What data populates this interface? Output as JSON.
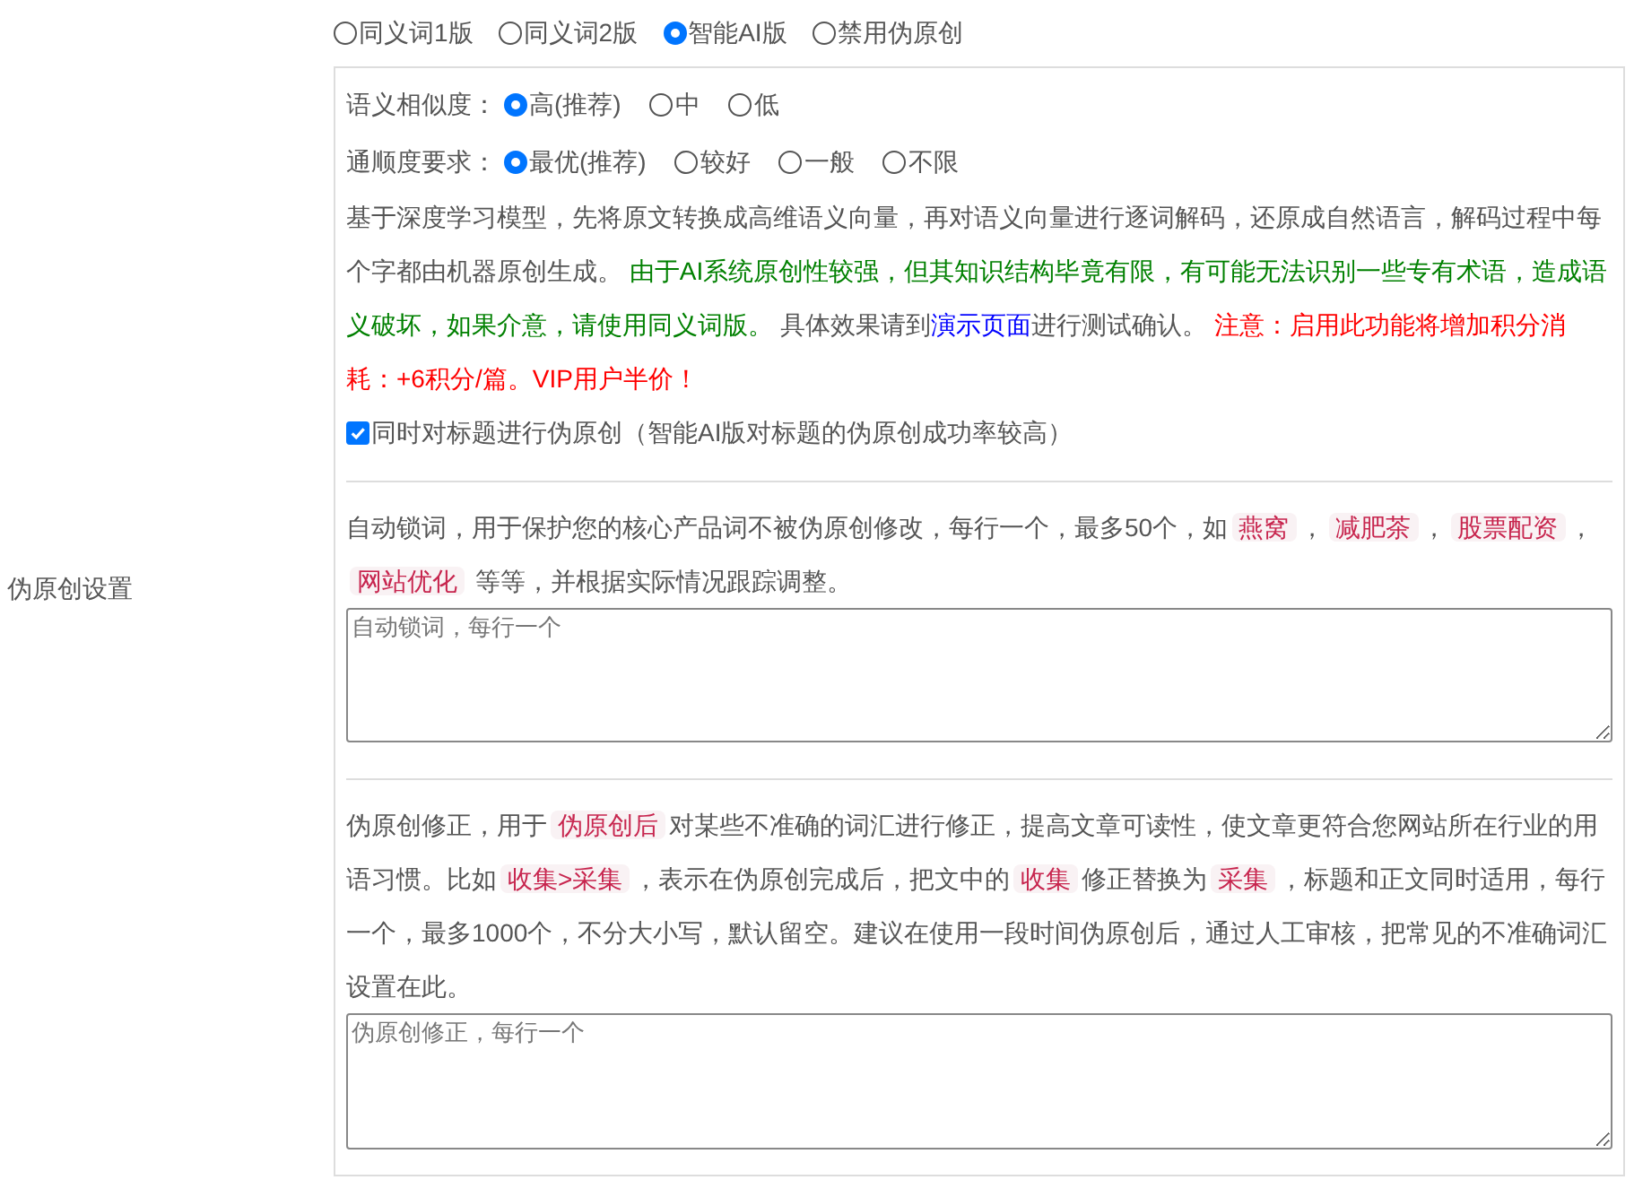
{
  "section_label": "伪原创设置",
  "mode_options": [
    {
      "label": "同义词1版",
      "selected": false
    },
    {
      "label": "同义词2版",
      "selected": false
    },
    {
      "label": "智能AI版",
      "selected": true
    },
    {
      "label": "禁用伪原创",
      "selected": false
    }
  ],
  "similarity": {
    "label": "语义相似度：",
    "options": [
      {
        "label": "高(推荐)",
        "selected": true
      },
      {
        "label": "中",
        "selected": false
      },
      {
        "label": "低",
        "selected": false
      }
    ]
  },
  "fluency": {
    "label": "通顺度要求：",
    "options": [
      {
        "label": "最优(推荐)",
        "selected": true
      },
      {
        "label": "较好",
        "selected": false
      },
      {
        "label": "一般",
        "selected": false
      },
      {
        "label": "不限",
        "selected": false
      }
    ]
  },
  "description": [
    {
      "kind": "text",
      "text": "基于深度学习模型，先将原文转换成高维语义向量，再对语义向量进行逐词解码，还原成自然语言，解码过程中每个字都由机器原创生成。 "
    },
    {
      "kind": "green",
      "text": "由于AI系统原创性较强，但其知识结构毕竟有限，有可能无法识别一些专有术语，造成语义破坏，如果介意，请使用同义词版。"
    },
    {
      "kind": "text",
      "text": " 具体效果请到"
    },
    {
      "kind": "link",
      "text": "演示页面"
    },
    {
      "kind": "text",
      "text": "进行测试确认。 "
    },
    {
      "kind": "red",
      "text": "注意：启用此功能将增加积分消耗：+6积分/篇。VIP用户半价！"
    }
  ],
  "title_checkbox": {
    "label": "同时对标题进行伪原创（智能AI版对标题的伪原创成功率较高）",
    "checked": true
  },
  "lock_words": {
    "description": [
      {
        "kind": "text",
        "text": "自动锁词，用于保护您的核心产品词不被伪原创修改，每行一个，最多50个，如"
      },
      {
        "kind": "tag",
        "text": "燕窝"
      },
      {
        "kind": "text",
        "text": "，"
      },
      {
        "kind": "tag",
        "text": "减肥茶"
      },
      {
        "kind": "text",
        "text": "，"
      },
      {
        "kind": "tag",
        "text": "股票配资"
      },
      {
        "kind": "text",
        "text": "，"
      },
      {
        "kind": "tag",
        "text": "网站优化"
      },
      {
        "kind": "text",
        "text": " 等等，并根据实际情况跟踪调整。"
      }
    ],
    "placeholder": "自动锁词，每行一个"
  },
  "corrections": {
    "description": [
      {
        "kind": "text",
        "text": "伪原创修正，用于"
      },
      {
        "kind": "tag",
        "text": "伪原创后"
      },
      {
        "kind": "text",
        "text": "对某些不准确的词汇进行修正，提高文章可读性，使文章更符合您网站所在行业的用语习惯。比如"
      },
      {
        "kind": "tag",
        "text": "收集>采集"
      },
      {
        "kind": "text",
        "text": "，表示在伪原创完成后，把文中的"
      },
      {
        "kind": "tag",
        "text": "收集"
      },
      {
        "kind": "text",
        "text": "修正替换为"
      },
      {
        "kind": "tag",
        "text": "采集"
      },
      {
        "kind": "text",
        "text": "，标题和正文同时适用，每行一个，最多1000个，不分大小写，默认留空。建议在使用一段时间伪原创后，通过人工审核，把常见的不准确词汇设置在此。"
      }
    ],
    "placeholder": "伪原创修正，每行一个"
  }
}
